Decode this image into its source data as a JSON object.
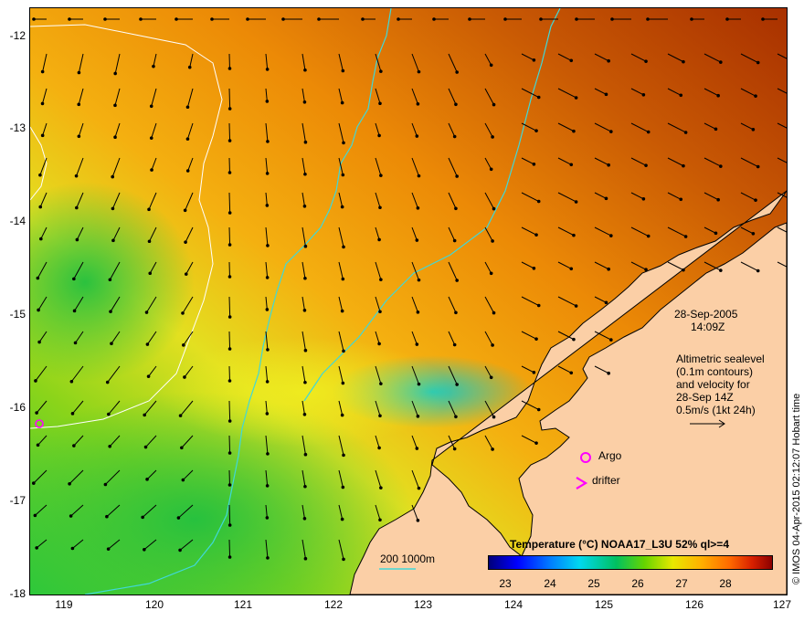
{
  "y_axis": {
    "ticks": [
      "-12",
      "-13",
      "-14",
      "-15",
      "-16",
      "-17",
      "-18"
    ]
  },
  "x_axis": {
    "ticks": [
      "119",
      "120",
      "121",
      "122",
      "123",
      "124",
      "125",
      "126",
      "127"
    ]
  },
  "datetime": {
    "date": "28-Sep-2005",
    "time": "14:09Z"
  },
  "info": {
    "line1": "Altimetric sealevel",
    "line2": "(0.1m contours)",
    "line3": "and velocity for",
    "line4": "28-Sep 14Z",
    "line5": "0.5m/s (1kt 24h)"
  },
  "markers": {
    "argo": "Argo",
    "drifter": "drifter"
  },
  "bathymetry_legend": "200  1000m",
  "colorbar": {
    "title": "Temperature (°C) NOAA17_L3U 52% ql>=4",
    "ticks": [
      "23",
      "24",
      "25",
      "26",
      "27",
      "28"
    ]
  },
  "credit": "© IMOS 04-Apr-2015 02:12:07 Hobart time",
  "colors": {
    "land": "#fbcfa6",
    "argo": "#ff00ff",
    "bathy": "#40d8d8",
    "contour": "#ffffff"
  }
}
